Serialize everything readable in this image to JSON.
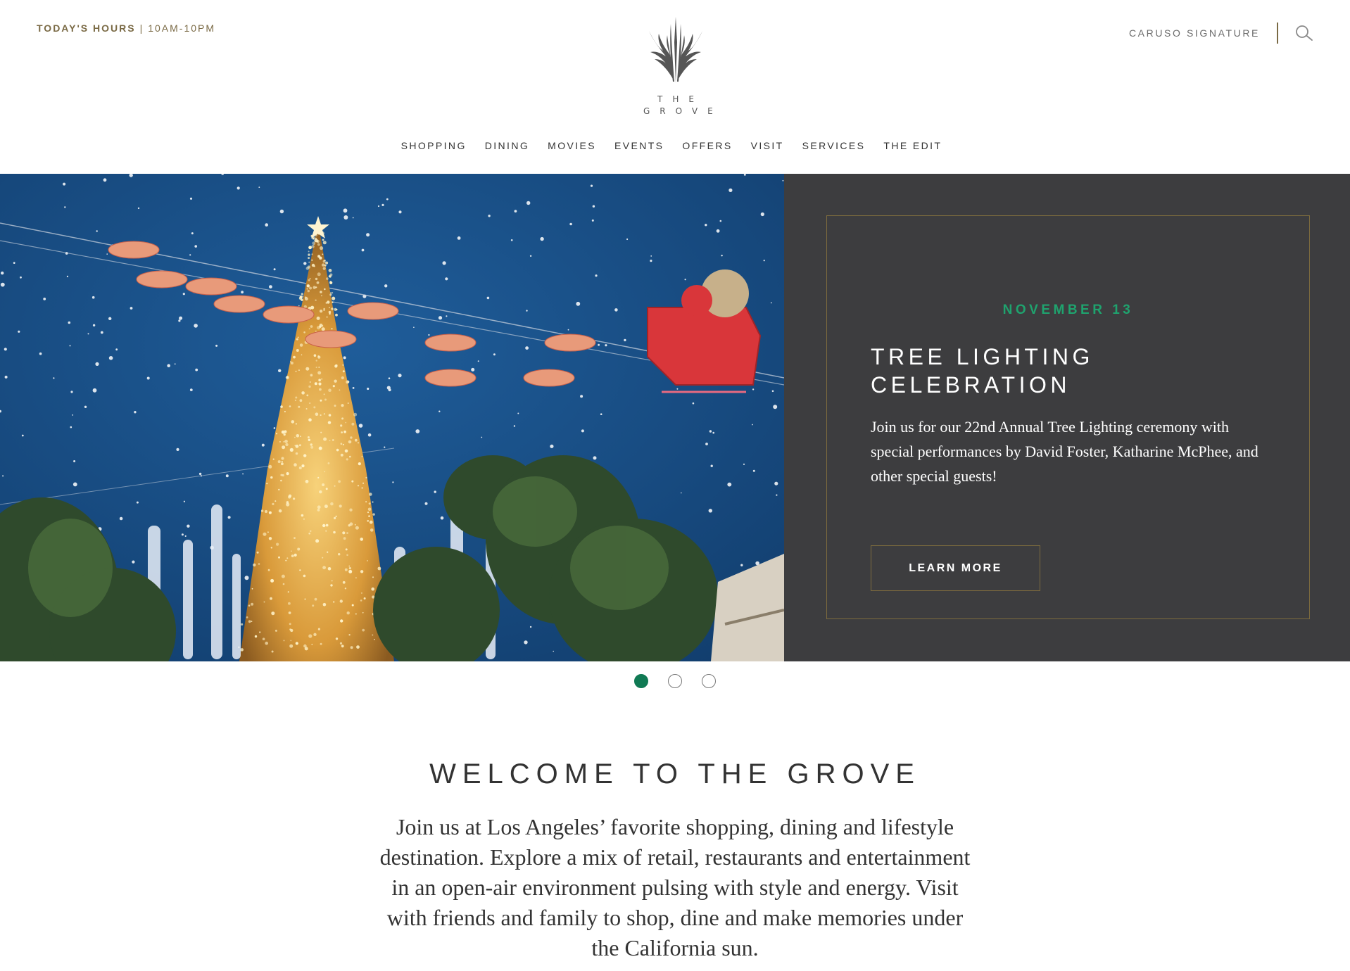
{
  "header": {
    "hours_label": "TODAY'S HOURS",
    "hours_separator": "|",
    "hours_value": "10AM-10PM",
    "logo_line1": "THE",
    "logo_line2": "GROVE",
    "caruso_link": "CARUSO SIGNATURE",
    "search_icon": "search-icon"
  },
  "nav": {
    "items": [
      "SHOPPING",
      "DINING",
      "MOVIES",
      "EVENTS",
      "OFFERS",
      "VISIT",
      "SERVICES",
      "THE EDIT"
    ]
  },
  "hero": {
    "date": "NOVEMBER 13",
    "title": "TREE LIGHTING CELEBRATION",
    "description": "Join us for our 22nd Annual Tree Lighting ceremony with special performances by David Foster, Katharine McPhee, and other special guests!",
    "button_label": "LEARN MORE",
    "slides_total": 3,
    "active_slide": 1
  },
  "welcome": {
    "title": "WELCOME TO THE GROVE",
    "text": "Join us at Los Angeles’ favorite shopping, dining and lifestyle destination. Explore a mix of retail, restaurants and entertainment in an open-air environment pulsing with style and energy. Visit with friends and family to shop, dine and make memories under the California sun."
  },
  "colors": {
    "accent_gold": "#7a6a45",
    "accent_green": "#1fa36e",
    "dot_active": "#117a54",
    "hero_panel": "#3d3d3f"
  }
}
